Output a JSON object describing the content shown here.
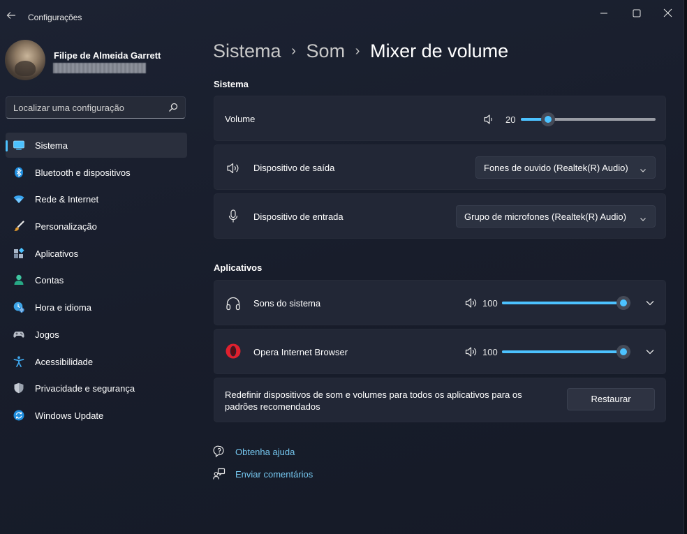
{
  "window": {
    "app_title": "Configurações",
    "back_icon": "back-arrow-icon",
    "controls": [
      "minimize-icon",
      "maximize-icon",
      "close-icon"
    ]
  },
  "profile": {
    "name": "Filipe de Almeida Garrett"
  },
  "search": {
    "placeholder": "Localizar uma configuração",
    "icon": "search-icon"
  },
  "sidebar": {
    "items": [
      {
        "label": "Sistema",
        "icon": "system-icon",
        "active": true
      },
      {
        "label": "Bluetooth e dispositivos",
        "icon": "bluetooth-icon",
        "active": false
      },
      {
        "label": "Rede & Internet",
        "icon": "wifi-icon",
        "active": false
      },
      {
        "label": "Personalização",
        "icon": "brush-icon",
        "active": false
      },
      {
        "label": "Aplicativos",
        "icon": "apps-icon",
        "active": false
      },
      {
        "label": "Contas",
        "icon": "account-icon",
        "active": false
      },
      {
        "label": "Hora e idioma",
        "icon": "time-language-icon",
        "active": false
      },
      {
        "label": "Jogos",
        "icon": "gamepad-icon",
        "active": false
      },
      {
        "label": "Acessibilidade",
        "icon": "accessibility-icon",
        "active": false
      },
      {
        "label": "Privacidade e segurança",
        "icon": "shield-icon",
        "active": false
      },
      {
        "label": "Windows Update",
        "icon": "windows-update-icon",
        "active": false
      }
    ]
  },
  "breadcrumb": {
    "items": [
      "Sistema",
      "Som",
      "Mixer de volume"
    ],
    "separator": "›"
  },
  "system_section": {
    "title": "Sistema",
    "volume": {
      "label": "Volume",
      "value": "20",
      "level": 0.2
    },
    "output": {
      "label": "Dispositivo de saída",
      "selected": "Fones de ouvido (Realtek(R) Audio)"
    },
    "input": {
      "label": "Dispositivo de entrada",
      "selected": "Grupo de microfones (Realtek(R) Audio)"
    }
  },
  "apps_section": {
    "title": "Aplicativos",
    "apps": [
      {
        "label": "Sons do sistema",
        "icon": "headphones-icon",
        "value": "100",
        "level": 1.0
      },
      {
        "label": "Opera Internet Browser",
        "icon": "opera-logo-icon",
        "value": "100",
        "level": 1.0
      }
    ],
    "reset": {
      "text": "Redefinir dispositivos de som e volumes para todos os aplicativos para os padrões recomendados",
      "button": "Restaurar"
    }
  },
  "links": {
    "help": "Obtenha ajuda",
    "feedback": "Enviar comentários"
  },
  "colors": {
    "accent": "#4cc2ff",
    "link": "#75c7ef",
    "background": "#191e2c",
    "card": "#222736"
  }
}
